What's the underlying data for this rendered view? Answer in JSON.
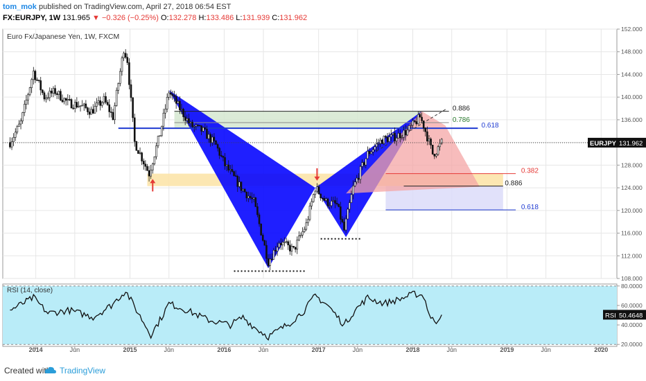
{
  "header": {
    "user": "tom_mok",
    "published": "published on TradingView.com, April 27, 2018 06:54 EST",
    "symbol": "FX:EURJPY, 1W",
    "last": "131.965",
    "change": "−0.326 (−0.25%)",
    "open_label": "O:",
    "open": "132.278",
    "high_label": "H:",
    "high": "133.486",
    "low_label": "L:",
    "low": "131.939",
    "close_label": "C:",
    "close": "131.962"
  },
  "footer": {
    "created": "Created with",
    "brand": "TradingView"
  },
  "colors": {
    "bear": "#0000ff",
    "bear_proj": "#f4a6a6",
    "rsi_band": "#b9ecf8",
    "fib_red": "#e53935",
    "fib_blue": "#1e3ad1",
    "fib_green": "#2e7d32",
    "bear_zone": "#d5e8d0",
    "demand_zone": "#fbe3a4",
    "blue_zone": "#dcdcf9"
  },
  "chart_data": [
    {
      "type": "candlestick",
      "title": "Euro Fx/Japanese Yen, 1W, FXCM",
      "symbol_badge": "EURJPY",
      "last_price": 131.962,
      "last_price_label": "131.962",
      "ylim": [
        108,
        152
      ],
      "y_ticks": [
        "108.000",
        "112.000",
        "116.000",
        "120.000",
        "124.000",
        "128.000",
        "132.000",
        "136.000",
        "140.000",
        "144.000",
        "148.000",
        "152.000"
      ],
      "x_ticks": [
        "2014",
        "Jun",
        "2015",
        "Jun",
        "2016",
        "Jun",
        "2017",
        "Jun",
        "2018",
        "Jun",
        "2019",
        "Jun",
        "2020"
      ],
      "x_tick_dates": [
        "2014-01-01",
        "2014-06-01",
        "2015-01-01",
        "2015-06-01",
        "2016-01-01",
        "2016-06-01",
        "2017-01-01",
        "2017-06-01",
        "2018-01-01",
        "2018-06-01",
        "2019-01-01",
        "2019-06-01",
        "2020-01-01"
      ],
      "price_path": [
        [
          "2013-09-23",
          132.0
        ],
        [
          "2013-11-04",
          135.5
        ],
        [
          "2013-12-23",
          144.5
        ],
        [
          "2014-02-03",
          140.0
        ],
        [
          "2014-03-17",
          141.0
        ],
        [
          "2014-05-05",
          139.0
        ],
        [
          "2014-06-23",
          138.5
        ],
        [
          "2014-08-04",
          137.5
        ],
        [
          "2014-09-22",
          139.5
        ],
        [
          "2014-10-27",
          136.5
        ],
        [
          "2014-12-08",
          148.5
        ],
        [
          "2014-12-22",
          146.5
        ],
        [
          "2015-01-19",
          132.0
        ],
        [
          "2015-02-09",
          130.0
        ],
        [
          "2015-03-16",
          126.5
        ],
        [
          "2015-04-27",
          133.5
        ],
        [
          "2015-06-01",
          141.0
        ],
        [
          "2015-07-13",
          138.0
        ],
        [
          "2015-08-24",
          135.0
        ],
        [
          "2015-10-12",
          134.0
        ],
        [
          "2015-11-30",
          131.5
        ],
        [
          "2016-01-04",
          128.0
        ],
        [
          "2016-03-07",
          124.0
        ],
        [
          "2016-04-25",
          121.5
        ],
        [
          "2016-06-20",
          111.0
        ],
        [
          "2016-08-01",
          114.5
        ],
        [
          "2016-09-26",
          113.0
        ],
        [
          "2016-11-14",
          117.5
        ],
        [
          "2016-12-19",
          124.0
        ],
        [
          "2017-01-30",
          121.5
        ],
        [
          "2017-03-13",
          121.0
        ],
        [
          "2017-04-10",
          116.5
        ],
        [
          "2017-05-15",
          124.0
        ],
        [
          "2017-07-10",
          130.0
        ],
        [
          "2017-09-04",
          132.5
        ],
        [
          "2017-10-23",
          133.0
        ],
        [
          "2017-12-11",
          134.0
        ],
        [
          "2018-01-29",
          136.5
        ],
        [
          "2018-02-12",
          135.0
        ],
        [
          "2018-03-19",
          130.0
        ],
        [
          "2018-04-02",
          130.5
        ],
        [
          "2018-04-23",
          132.0
        ]
      ],
      "harmonic_pattern": {
        "name": "bat",
        "points": [
          [
            "2015-06-01",
            141.2
          ],
          [
            "2016-06-20",
            109.8
          ],
          [
            "2016-12-19",
            124.0
          ],
          [
            "2017-04-17",
            115.3
          ],
          [
            "2018-02-05",
            137.5
          ]
        ],
        "projection": [
          [
            "2018-02-05",
            137.5
          ],
          [
            "2018-05-07",
            135.0
          ],
          [
            "2018-09-17",
            124.2
          ],
          [
            "2017-04-17",
            123.0
          ]
        ]
      },
      "fib_levels": [
        {
          "label": "0.886",
          "value": 137.5,
          "style": "dark"
        },
        {
          "label": "0.786",
          "value": 135.5,
          "style": "green"
        },
        {
          "label": "0.618",
          "value": 134.5,
          "style": "blue"
        },
        {
          "label": "0.382",
          "value": 126.5,
          "style": "red"
        },
        {
          "label": "0.886",
          "value": 124.3,
          "style": "dark"
        },
        {
          "label": "0.618",
          "value": 120.1,
          "style": "blue"
        }
      ],
      "zones": [
        {
          "name": "supply-zone",
          "y": [
            134.5,
            137.5
          ],
          "x": [
            "2015-06-22",
            "2018-02-05"
          ],
          "color": "green"
        },
        {
          "name": "demand-zone",
          "y": [
            124.3,
            126.5
          ],
          "x": [
            "2015-03-09",
            "2018-12-17"
          ],
          "color": "yellow"
        },
        {
          "name": "target-zone",
          "y": [
            120.1,
            124.3
          ],
          "x": [
            "2017-09-18",
            "2018-12-17"
          ],
          "color": "blue"
        }
      ],
      "support_lines": [
        {
          "value": 109.3,
          "x": [
            "2016-02-08",
            "2016-11-14"
          ]
        },
        {
          "value": 115.0,
          "x": [
            "2017-01-09",
            "2017-06-12"
          ]
        }
      ],
      "arrows": [
        {
          "dir": "up",
          "date": "2015-03-30",
          "value": 125.8
        },
        {
          "dir": "down",
          "date": "2016-12-26",
          "value": 125.0
        }
      ]
    },
    {
      "type": "line",
      "title": "RSI (14, close)",
      "last_value": 50.4648,
      "badge_label": "RSI",
      "badge_value": "50.4648",
      "ylim": [
        18,
        82
      ],
      "y_ticks": [
        "20.0000",
        "40.0000",
        "60.0000",
        "80.0000"
      ],
      "band": [
        20,
        80
      ],
      "path": [
        [
          "2013-09-23",
          55
        ],
        [
          "2013-12-23",
          68
        ],
        [
          "2014-02-17",
          52
        ],
        [
          "2014-05-12",
          55
        ],
        [
          "2014-08-11",
          48
        ],
        [
          "2014-10-20",
          60
        ],
        [
          "2014-12-15",
          75
        ],
        [
          "2015-02-02",
          52
        ],
        [
          "2015-03-23",
          30
        ],
        [
          "2015-05-04",
          48
        ],
        [
          "2015-06-01",
          62
        ],
        [
          "2015-08-10",
          55
        ],
        [
          "2015-11-02",
          45
        ],
        [
          "2016-01-25",
          40
        ],
        [
          "2016-03-14",
          48
        ],
        [
          "2016-04-25",
          38
        ],
        [
          "2016-06-20",
          28
        ],
        [
          "2016-09-12",
          42
        ],
        [
          "2016-11-07",
          55
        ],
        [
          "2016-12-19",
          70
        ],
        [
          "2017-02-06",
          60
        ],
        [
          "2017-04-10",
          40
        ],
        [
          "2017-05-22",
          55
        ],
        [
          "2017-07-10",
          68
        ],
        [
          "2017-09-11",
          62
        ],
        [
          "2017-11-06",
          66
        ],
        [
          "2018-01-08",
          72
        ],
        [
          "2018-02-12",
          70
        ],
        [
          "2018-03-12",
          46
        ],
        [
          "2018-04-02",
          44
        ],
        [
          "2018-04-23",
          50.46
        ]
      ]
    }
  ]
}
